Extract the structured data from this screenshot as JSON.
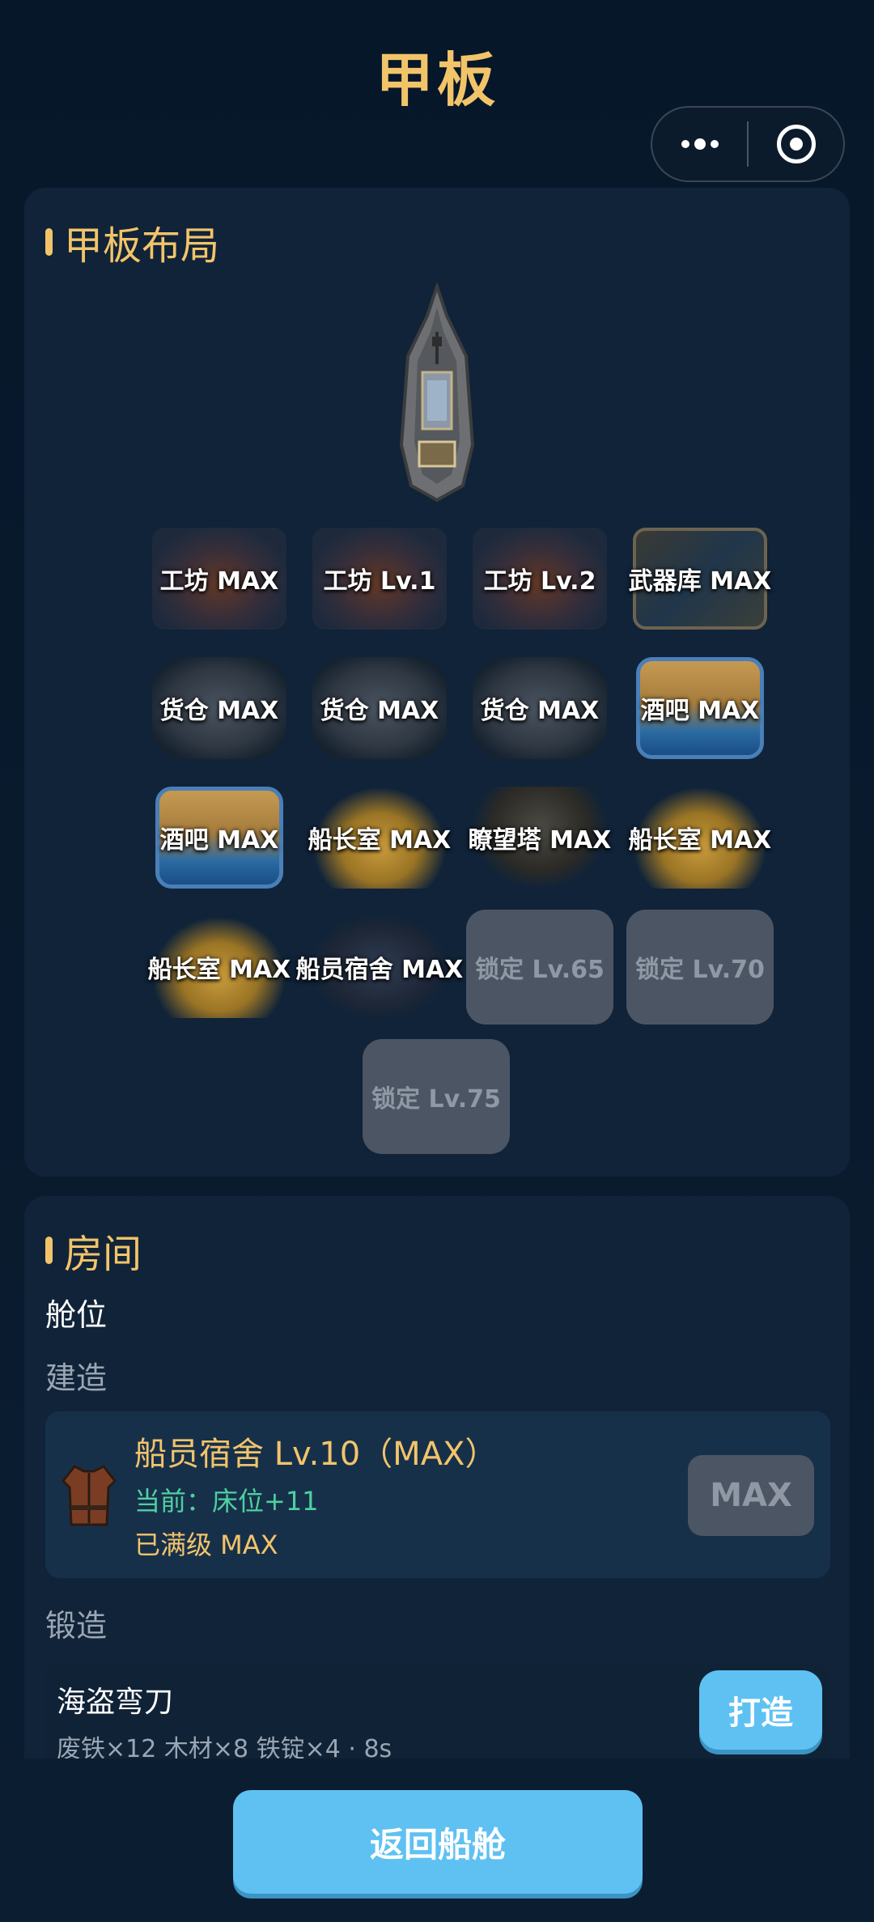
{
  "header": {
    "title": "甲板",
    "menu_icon": "more-dots-icon",
    "close_icon": "target-close-icon"
  },
  "deck": {
    "section_title": "甲板布局",
    "slots": [
      {
        "label": "工坊 MAX",
        "art": "workshop"
      },
      {
        "label": "工坊 Lv.1",
        "art": "workshop"
      },
      {
        "label": "工坊 Lv.2",
        "art": "workshop"
      },
      {
        "label": "武器库 MAX",
        "art": "armory"
      },
      {
        "label": "货仓 MAX",
        "art": "cargo"
      },
      {
        "label": "货仓 MAX",
        "art": "cargo"
      },
      {
        "label": "货仓 MAX",
        "art": "cargo"
      },
      {
        "label": "酒吧 MAX",
        "art": "bar"
      },
      {
        "label": "酒吧 MAX",
        "art": "bar"
      },
      {
        "label": "船长室 MAX",
        "art": "captain"
      },
      {
        "label": "瞭望塔 MAX",
        "art": "tower"
      },
      {
        "label": "船长室 MAX",
        "art": "captain"
      },
      {
        "label": "船长室 MAX",
        "art": "captain"
      },
      {
        "label": "船员宿舍 MAX",
        "art": "crew"
      },
      {
        "label": "锁定 Lv.65",
        "art": "locked"
      },
      {
        "label": "锁定 Lv.70",
        "art": "locked"
      },
      {
        "label": "锁定 Lv.75",
        "art": "locked"
      }
    ]
  },
  "room": {
    "section_title": "房间",
    "cabin_label": "舱位",
    "build_label": "建造",
    "build": {
      "name": "船员宿舍  Lv.10（MAX）",
      "current": "当前：床位+11",
      "status": "已满级 MAX",
      "button": "MAX"
    },
    "forge_label": "锻造",
    "forge": {
      "name": "海盗弯刀",
      "requirements": "废铁×12  木材×8  铁锭×4 · 8s",
      "button": "打造"
    }
  },
  "footer": {
    "back_button": "返回船舱"
  },
  "colors": {
    "accent": "#f2c46a",
    "button": "#5ec1f2",
    "current_value": "#4fd0a0",
    "locked": "#4b5564"
  }
}
